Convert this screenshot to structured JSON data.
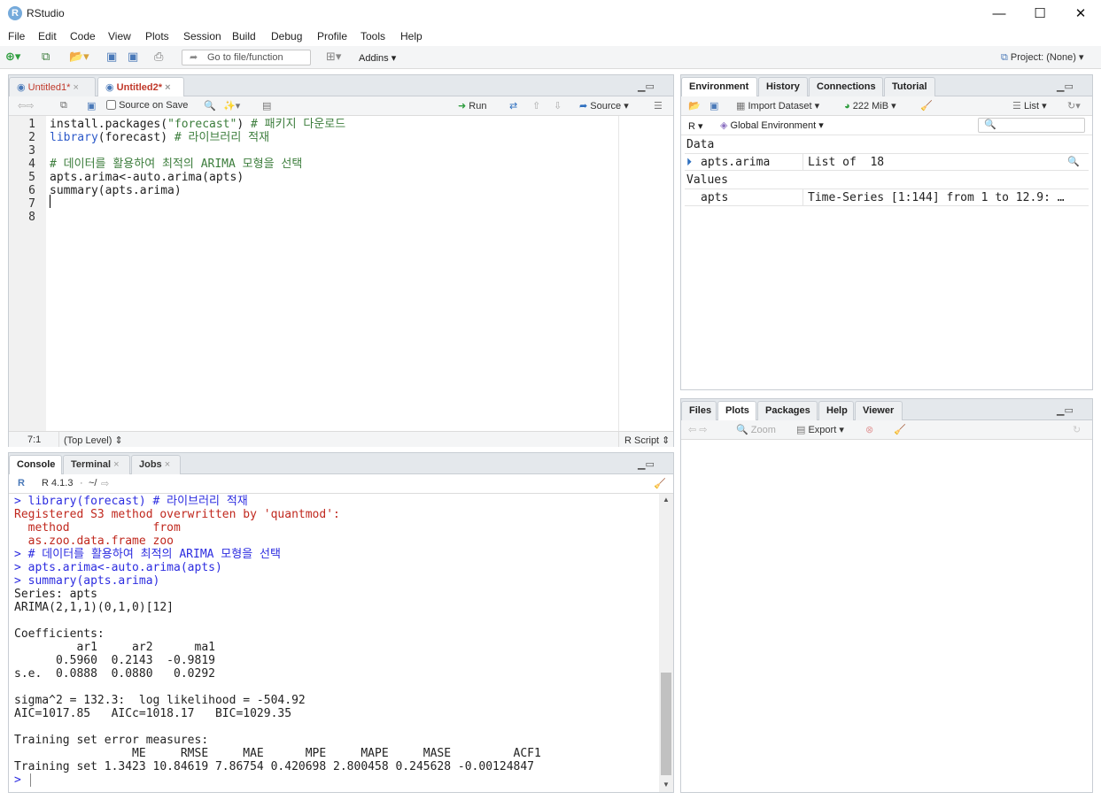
{
  "window": {
    "title": "RStudio",
    "logo": "R"
  },
  "menu": [
    "File",
    "Edit",
    "Code",
    "View",
    "Plots",
    "Session",
    "Build",
    "Debug",
    "Profile",
    "Tools",
    "Help"
  ],
  "toolbar": {
    "goto_placeholder": "Go to file/function",
    "addins": "Addins",
    "project": "Project: (None)"
  },
  "editor": {
    "tabs": [
      "Untitled1*",
      "Untitled2*"
    ],
    "source_on_save": "Source on Save",
    "run": "Run",
    "source": "Source",
    "lines": [
      {
        "n": "1",
        "parts": [
          {
            "t": "install.packages(",
            "c": ""
          },
          {
            "t": "\"forecast\"",
            "c": "str"
          },
          {
            "t": ") ",
            "c": ""
          },
          {
            "t": "# 패키지 다운로드",
            "c": "cm"
          }
        ]
      },
      {
        "n": "2",
        "parts": [
          {
            "t": "library",
            "c": "fn"
          },
          {
            "t": "(forecast) ",
            "c": ""
          },
          {
            "t": "# 라이브러리 적재",
            "c": "cm"
          }
        ]
      },
      {
        "n": "3",
        "parts": []
      },
      {
        "n": "4",
        "parts": [
          {
            "t": "# 데이터를 활용하여 최적의 ARIMA 모형을 선택",
            "c": "cm"
          }
        ]
      },
      {
        "n": "5",
        "parts": [
          {
            "t": "apts.arima<-auto.arima(apts)",
            "c": ""
          }
        ]
      },
      {
        "n": "6",
        "parts": [
          {
            "t": "summary(apts.arima)",
            "c": ""
          }
        ]
      },
      {
        "n": "7",
        "parts": []
      },
      {
        "n": "8",
        "parts": []
      }
    ],
    "status": {
      "pos": "7:1",
      "scope": "(Top Level)",
      "type": "R Script"
    }
  },
  "console": {
    "tabs": [
      "Console",
      "Terminal",
      "Jobs"
    ],
    "version": "R 4.1.3",
    "path": "~/",
    "lines": [
      {
        "t": "> library(forecast) # 라이브러리 적재",
        "c": "cin"
      },
      {
        "t": "Registered S3 method overwritten by 'quantmod':",
        "c": "cerr"
      },
      {
        "t": "  method            from",
        "c": "cerr"
      },
      {
        "t": "  as.zoo.data.frame zoo",
        "c": "cerr"
      },
      {
        "t": "> # 데이터를 활용하여 최적의 ARIMA 모형을 선택",
        "c": "cin"
      },
      {
        "t": "> apts.arima<-auto.arima(apts)",
        "c": "cin"
      },
      {
        "t": "> summary(apts.arima)",
        "c": "cin"
      },
      {
        "t": "Series: apts",
        "c": "cout"
      },
      {
        "t": "ARIMA(2,1,1)(0,1,0)[12]",
        "c": "cout"
      },
      {
        "t": "",
        "c": "cout"
      },
      {
        "t": "Coefficients:",
        "c": "cout"
      },
      {
        "t": "         ar1     ar2      ma1",
        "c": "cout"
      },
      {
        "t": "      0.5960  0.2143  -0.9819",
        "c": "cout"
      },
      {
        "t": "s.e.  0.0888  0.0880   0.0292",
        "c": "cout"
      },
      {
        "t": "",
        "c": "cout"
      },
      {
        "t": "sigma^2 = 132.3:  log likelihood = -504.92",
        "c": "cout"
      },
      {
        "t": "AIC=1017.85   AICc=1018.17   BIC=1029.35",
        "c": "cout"
      },
      {
        "t": "",
        "c": "cout"
      },
      {
        "t": "Training set error measures:",
        "c": "cout"
      },
      {
        "t": "                 ME     RMSE     MAE      MPE     MAPE     MASE         ACF1",
        "c": "cout"
      },
      {
        "t": "Training set 1.3423 10.84619 7.86754 0.420698 2.800458 0.245628 -0.00124847",
        "c": "cout"
      },
      {
        "t": "> ",
        "c": "cin"
      }
    ]
  },
  "environment": {
    "tabs": [
      "Environment",
      "History",
      "Connections",
      "Tutorial"
    ],
    "import": "Import Dataset",
    "memory": "222 MiB",
    "view": "List",
    "lang": "R",
    "scope": "Global Environment",
    "data_header": "Data",
    "data": [
      {
        "name": "apts.arima",
        "value": "List of  18"
      }
    ],
    "values_header": "Values",
    "values": [
      {
        "name": "apts",
        "value": "Time-Series [1:144] from 1 to 12.9: …"
      }
    ]
  },
  "files": {
    "tabs": [
      "Files",
      "Plots",
      "Packages",
      "Help",
      "Viewer"
    ],
    "zoom": "Zoom",
    "export": "Export"
  }
}
